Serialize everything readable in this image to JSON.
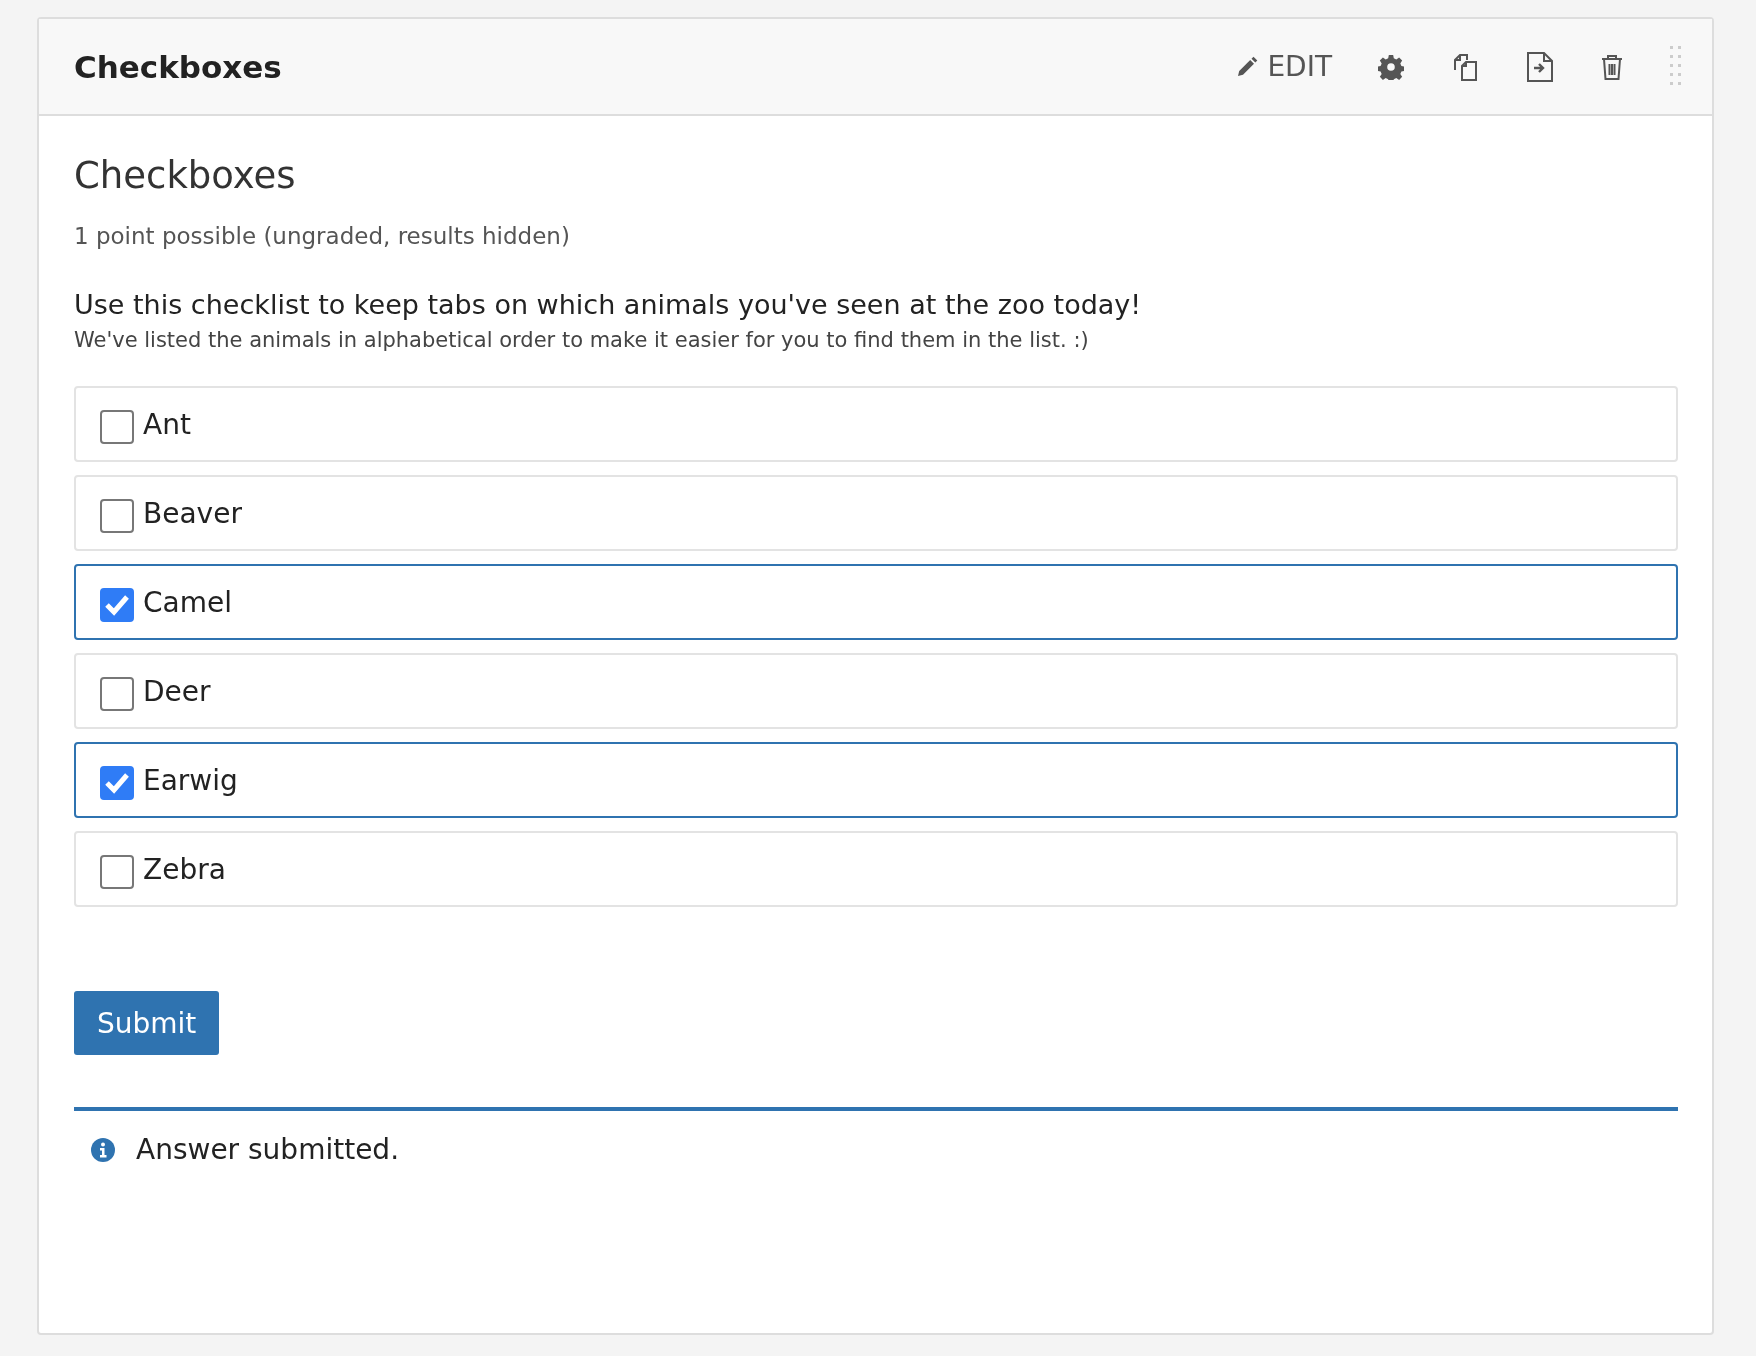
{
  "header": {
    "title": "Checkboxes",
    "edit_label": "EDIT"
  },
  "problem": {
    "title": "Checkboxes",
    "points": "1 point possible (ungraded, results hidden)",
    "prompt": "Use this checklist to keep tabs on which animals you've seen at the zoo today!",
    "hint": "We've listed the animals in alphabetical order to make it easier for you to find them in the list. :)"
  },
  "options": [
    {
      "label": "Ant",
      "checked": false
    },
    {
      "label": "Beaver",
      "checked": false
    },
    {
      "label": "Camel",
      "checked": true
    },
    {
      "label": "Deer",
      "checked": false
    },
    {
      "label": "Earwig",
      "checked": true
    },
    {
      "label": "Zebra",
      "checked": false
    }
  ],
  "submit_label": "Submit",
  "status": {
    "message": "Answer submitted."
  }
}
